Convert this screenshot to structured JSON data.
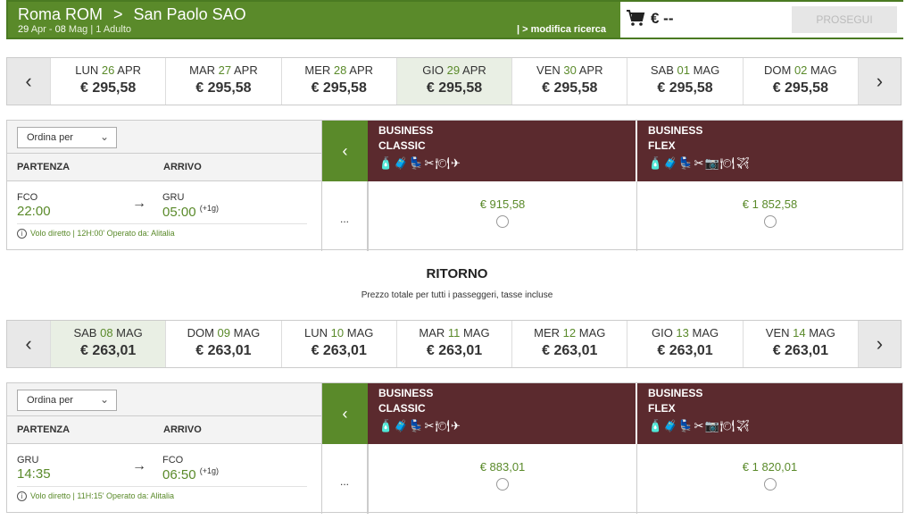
{
  "header": {
    "origin": "Roma ROM",
    "destination": "San Paolo SAO",
    "date_out": "29",
    "month_out": " Apr - ",
    "date_back": "08",
    "month_back": " Mag | 1 Adulto",
    "modify": "| > modifica ricerca",
    "cart_price": "€ --",
    "continue_label": "PROSEGUI"
  },
  "outbound_dates": [
    {
      "dow": "LUN ",
      "day": "26",
      "mon": " APR",
      "price": "€ 295,58"
    },
    {
      "dow": "MAR ",
      "day": "27",
      "mon": " APR",
      "price": "€ 295,58"
    },
    {
      "dow": "MER ",
      "day": "28",
      "mon": " APR",
      "price": "€ 295,58"
    },
    {
      "dow": "GIO ",
      "day": "29",
      "mon": " APR",
      "price": "€ 295,58"
    },
    {
      "dow": "VEN ",
      "day": "30",
      "mon": " APR",
      "price": "€ 295,58"
    },
    {
      "dow": "SAB ",
      "day": "01",
      "mon": " MAG",
      "price": "€ 295,58"
    },
    {
      "dow": "DOM ",
      "day": "02",
      "mon": " MAG",
      "price": "€ 295,58"
    }
  ],
  "return_dates": [
    {
      "dow": "SAB ",
      "day": "08",
      "mon": " MAG",
      "price": "€ 263,01"
    },
    {
      "dow": "DOM ",
      "day": "09",
      "mon": " MAG",
      "price": "€ 263,01"
    },
    {
      "dow": "LUN ",
      "day": "10",
      "mon": " MAG",
      "price": "€ 263,01"
    },
    {
      "dow": "MAR ",
      "day": "11",
      "mon": " MAG",
      "price": "€ 263,01"
    },
    {
      "dow": "MER ",
      "day": "12",
      "mon": " MAG",
      "price": "€ 263,01"
    },
    {
      "dow": "GIO ",
      "day": "13",
      "mon": " MAG",
      "price": "€ 263,01"
    },
    {
      "dow": "VEN ",
      "day": "14",
      "mon": " MAG",
      "price": "€ 263,01"
    }
  ],
  "table": {
    "sort_label": "Ordina per",
    "col_departure": "PARTENZA",
    "col_arrival": "ARRIVO",
    "more": "...",
    "fare1_line1": "BUSINESS",
    "fare1_line2": "CLASSIC",
    "fare2_line1": "BUSINESS",
    "fare2_line2": "FLEX",
    "fare1_icons": "🧴🧳💺✂🍽✈",
    "fare2_icons": "🧴🧳💺✂📷🍽✈"
  },
  "outbound_flight": {
    "from_code": "FCO",
    "from_time": "22:00",
    "to_code": "GRU",
    "to_time": "05:00",
    "day_offset": "(+1g)",
    "info": "Volo diretto | 12H:00' Operato da: Alitalia",
    "fare1_price": "€ 915,58",
    "fare2_price": "€ 1 852,58"
  },
  "return_section": {
    "title": "RITORNO",
    "subtitle": "Prezzo totale per tutti i passeggeri, tasse incluse"
  },
  "return_flight": {
    "from_code": "GRU",
    "from_time": "14:35",
    "to_code": "FCO",
    "to_time": "06:50",
    "day_offset": "(+1g)",
    "info": "Volo diretto | 11H:15' Operato da: Alitalia",
    "fare1_price": "€ 883,01",
    "fare2_price": "€ 1 820,01"
  },
  "colors": {
    "brand_green": "#5a8a2a",
    "fare_header": "#5b2a2e"
  }
}
